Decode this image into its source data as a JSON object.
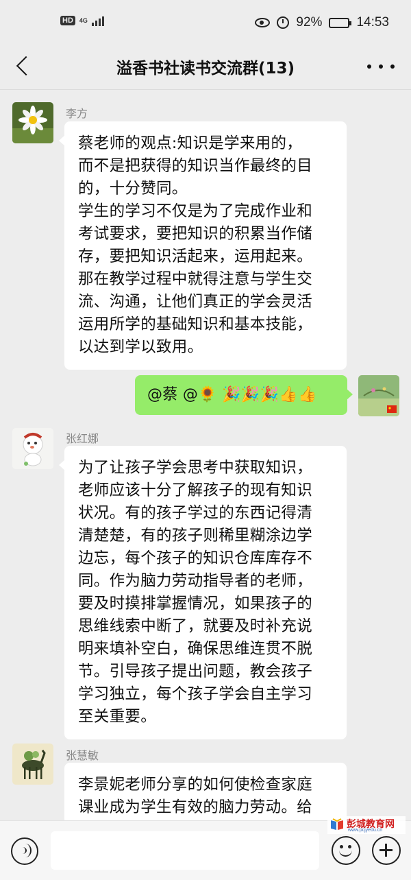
{
  "status_bar": {
    "hd": "HD",
    "network": "4G",
    "battery_percent": "92%",
    "time": "14:53",
    "icons": [
      "eye-icon",
      "alarm-icon",
      "battery-icon",
      "signal-icon"
    ]
  },
  "header": {
    "title": "溢香书社读书交流群(13)",
    "icons": [
      "back-arrow-icon",
      "more-dots-icon"
    ]
  },
  "messages": [
    {
      "sender": "李方",
      "side": "left",
      "text": "蔡老师的观点:知识是学来用的，\n而不是把获得的知识当作最终的目\n的，十分赞同。\n学生的学习不仅是为了完成作业和\n考试要求，要把知识的积累当作储\n存，要把知识活起来，运用起来。\n那在教学过程中就得注意与学生交\n流、沟通，让他们真正的学会灵活\n运用所学的基础知识和基本技能，\n以达到学以致用。"
    },
    {
      "side": "right",
      "text": "@蔡  @🌻 🎉🎉🎉👍👍"
    },
    {
      "sender": "张红娜",
      "side": "left",
      "text": "为了让孩子学会思考中获取知识，\n老师应该十分了解孩子的现有知识\n状况。有的孩子学过的东西记得清\n清楚楚，有的孩子则稀里糊涂边学\n边忘，每个孩子的知识仓库库存不\n同。作为脑力劳动指导者的老师，\n要及时摸排掌握情况，如果孩子的\n思维线索中断了，就要及时补充说\n明来填补空白，确保思维连贯不脱\n节。引导孩子提出问题，教会孩子\n学习独立，每个孩子学会自主学习\n至关重要。"
    },
    {
      "sender": "张慧敏",
      "side": "left",
      "text": "李景妮老师分享的如何使检查家庭\n课业成为学生有效的脑力劳动。给\n他方法都有实践性，我站为酒实法"
    }
  ],
  "input_bar": {
    "icons": [
      "voice-icon",
      "emoji-icon",
      "plus-icon"
    ]
  },
  "watermark": {
    "title": "彭城教育网",
    "url": "www.pcjyedu.cn"
  },
  "colors": {
    "background": "#ededed",
    "self_bubble": "#95ec69",
    "other_bubble": "#ffffff",
    "watermark_red": "#d12020"
  }
}
